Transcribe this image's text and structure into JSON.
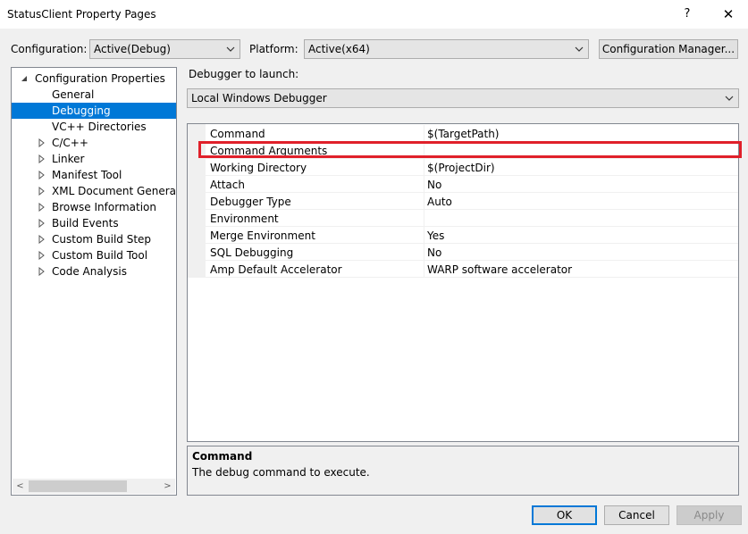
{
  "window": {
    "title": "StatusClient Property Pages",
    "help_label": "?",
    "close_label": "✕"
  },
  "toolbar": {
    "configuration_label": "Configuration:",
    "configuration_value": "Active(Debug)",
    "platform_label": "Platform:",
    "platform_value": "Active(x64)",
    "config_manager_label": "Configuration Manager..."
  },
  "tree": {
    "items": [
      {
        "label": "Configuration Properties",
        "expander": "expanded"
      },
      {
        "label": "General",
        "expander": "none"
      },
      {
        "label": "Debugging",
        "expander": "none",
        "selected": true
      },
      {
        "label": "VC++ Directories",
        "expander": "none"
      },
      {
        "label": "C/C++",
        "expander": "collapsed"
      },
      {
        "label": "Linker",
        "expander": "collapsed"
      },
      {
        "label": "Manifest Tool",
        "expander": "collapsed"
      },
      {
        "label": "XML Document Generator",
        "expander": "collapsed"
      },
      {
        "label": "Browse Information",
        "expander": "collapsed"
      },
      {
        "label": "Build Events",
        "expander": "collapsed"
      },
      {
        "label": "Custom Build Step",
        "expander": "collapsed"
      },
      {
        "label": "Custom Build Tool",
        "expander": "collapsed"
      },
      {
        "label": "Code Analysis",
        "expander": "collapsed"
      }
    ],
    "scroll_left": "<",
    "scroll_right": ">"
  },
  "debugger": {
    "label": "Debugger to launch:",
    "value": "Local Windows Debugger"
  },
  "properties": [
    {
      "name": "Command",
      "value": "$(TargetPath)"
    },
    {
      "name": "Command Arguments",
      "value": ""
    },
    {
      "name": "Working Directory",
      "value": "$(ProjectDir)"
    },
    {
      "name": "Attach",
      "value": "No"
    },
    {
      "name": "Debugger Type",
      "value": "Auto"
    },
    {
      "name": "Environment",
      "value": ""
    },
    {
      "name": "Merge Environment",
      "value": "Yes"
    },
    {
      "name": "SQL Debugging",
      "value": "No"
    },
    {
      "name": "Amp Default Accelerator",
      "value": "WARP software accelerator"
    }
  ],
  "description": {
    "title": "Command",
    "text": "The debug command to execute."
  },
  "buttons": {
    "ok": "OK",
    "cancel": "Cancel",
    "apply": "Apply"
  },
  "colors": {
    "selection": "#0078d7",
    "highlight_box": "#e0202a"
  }
}
